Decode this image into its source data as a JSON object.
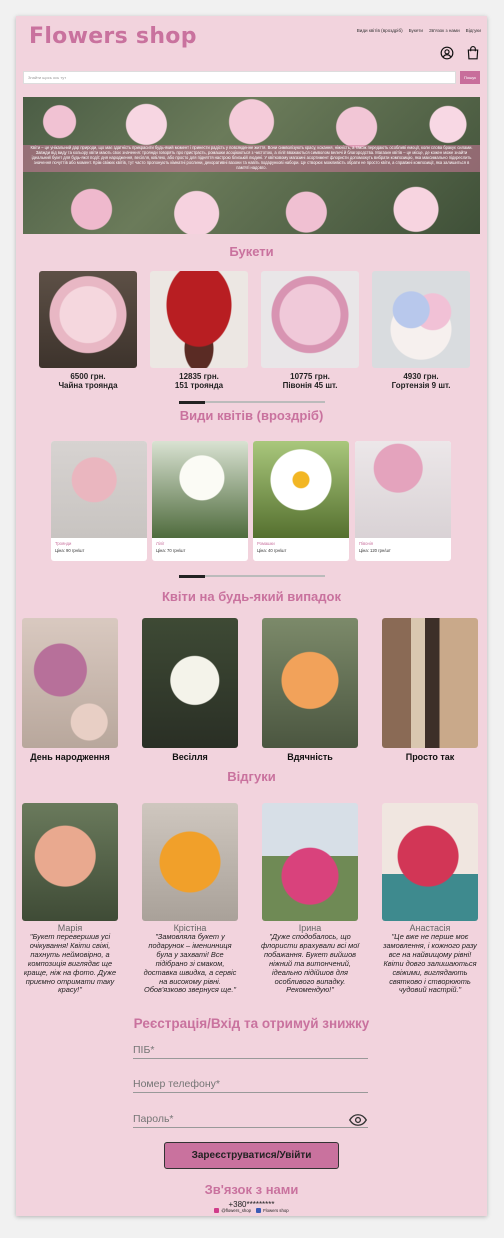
{
  "header": {
    "logo": "Flowers shop",
    "nav": [
      "Види квітів (вроздріб)",
      "Букети",
      "Зв'язок з нами",
      "Відгуки"
    ],
    "icons": [
      "user-circle-icon",
      "shopping-bag-icon"
    ]
  },
  "search": {
    "placeholder": "Знайти щось ось тут",
    "button": "Пошук"
  },
  "hero": {
    "text": "Квіти – це унікальний дар природи, що має здатність прикрасити будь-який момент і принести радість у повсякденне життя. Вони символізують красу, кохання, ніжність, а також передають особливі емоції, коли слова бракує силами. Завжди від виду та кольору квіти мають своє значення: троянди говорять про пристрасть, ромашки асоціюються з чистотою, а лілії вважаються символом величі й благородства. Магазин квітів – це місце, де кожен може знайти ідеальний букет для будь-якої події: дня народження, весілля, ювілею, або просто для підняття настрою близькій людині. У квітковому магазині асортимент флористи допоможуть вибрати композицію, яка максимально підкреслить значення почуттів або момент. Крім свіжих квітів, тут часто пропонують кімнатні рослини, декоративні вазони та навіть подарункові набори. Це створює можливість обрати не просто квіти, а справжні композиції, яка залишиться в пам'яті надовго."
  },
  "bouquets": {
    "title": "Букети",
    "items": [
      {
        "price": "6500 грн.",
        "name": "Чайна троянда"
      },
      {
        "price": "12835 грн.",
        "name": "151 троянда"
      },
      {
        "price": "10775 грн.",
        "name": "Півонія 45 шт."
      },
      {
        "price": "4930 грн.",
        "name": "Гортензія 9 шт."
      }
    ]
  },
  "flowers": {
    "title": "Види квітів (вроздріб)",
    "items": [
      {
        "name": "Троянди",
        "price": "Ціна: 90 грн/шт"
      },
      {
        "name": "Лілії",
        "price": "Ціна: 70 грн/шт"
      },
      {
        "name": "Ромашки",
        "price": "Ціна: 40 грн/шт"
      },
      {
        "name": "Півонія",
        "price": "Ціна: 120 грн/шт"
      }
    ]
  },
  "occasions": {
    "title": "Квіти на будь-який випадок",
    "items": [
      "День народження",
      "Весілля",
      "Вдячність",
      "Просто так"
    ]
  },
  "reviews": {
    "title": "Відгуки",
    "items": [
      {
        "name": "Марія",
        "text": "\"Букет перевершив усі очікування! Квіти свіжі, пахнуть неймовірно, а композиція виглядає ще краще, ніж на фото. Дуже приємно отримати таку красу!\""
      },
      {
        "name": "Крістіна",
        "text": "\"Замовляла букет у подарунок – іменинниця була у захваті! Все підібрано зі смаком, доставка швидка, а сервіс на високому рівні. Обов'язково звернуся ще.\""
      },
      {
        "name": "Ірина",
        "text": "\"Дуже сподобалось, що флористи врахували всі мої побажання. Букет вийшов ніжний та витончений, ідеально підійшов для особливого випадку. Рекомендую!\""
      },
      {
        "name": "Анастасія",
        "text": "\"Це вже не перше моє замовлення, і кожного разу все на найвищому рівні! Квіти довго залишаються свіжими, виглядають святково і створюють чудовий настрій.\""
      }
    ]
  },
  "register": {
    "title": "Реєстрація/Вхід та отримуй знижку",
    "name_placeholder": "ПІБ*",
    "phone_placeholder": "Номер телефону*",
    "password_placeholder": "Пароль*",
    "button": "Зареєструватися/Увійти"
  },
  "contact": {
    "title": "Зв'язок з нами",
    "phone": "+380*********",
    "instagram": "@flowers_shop",
    "facebook": "Flowers shop"
  },
  "colors": {
    "accent": "#c9729e",
    "background": "#f2d3dd"
  },
  "carousel": {
    "bouquets_progress": 0.18,
    "flowers_progress": 0.18
  }
}
